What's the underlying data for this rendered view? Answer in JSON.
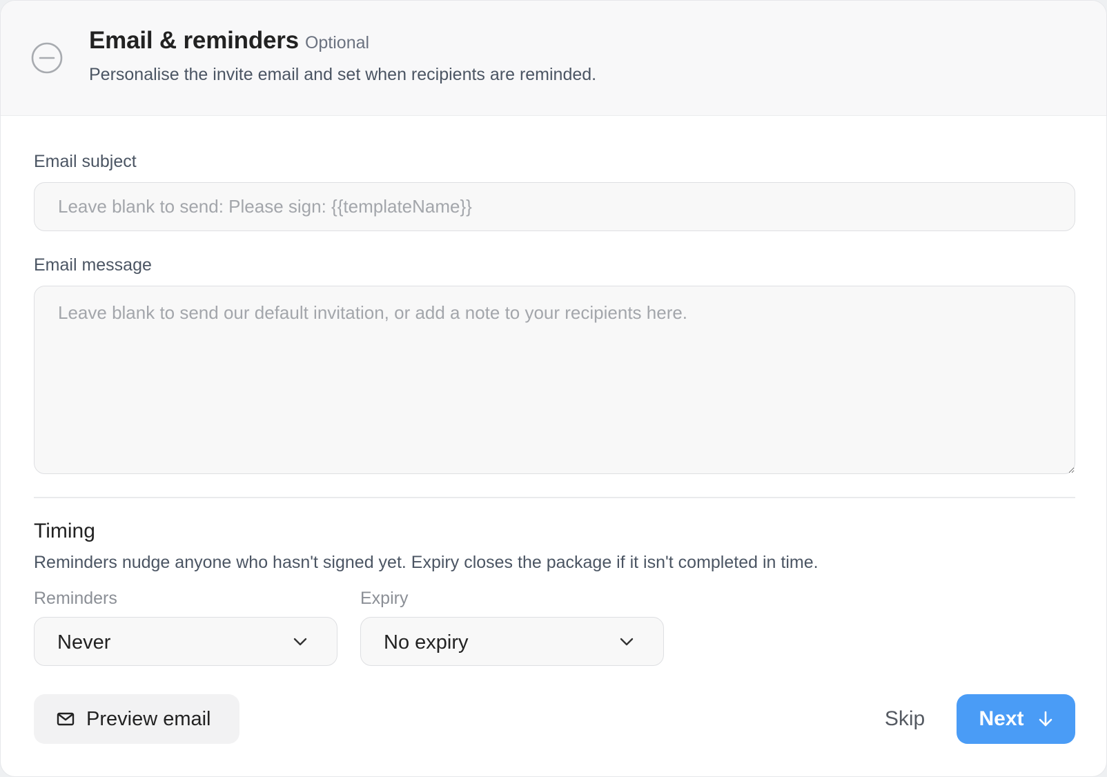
{
  "header": {
    "title": "Email & reminders",
    "optional_badge": "Optional",
    "subtitle": "Personalise the invite email and set when recipients are reminded.",
    "step_icon": "minus-circle-icon"
  },
  "email_subject": {
    "label": "Email subject",
    "value": "",
    "placeholder": "Leave blank to send: Please sign: {{templateName}}"
  },
  "email_message": {
    "label": "Email message",
    "value": "",
    "placeholder": "Leave blank to send our default invitation, or add a note to your recipients here."
  },
  "timing": {
    "title": "Timing",
    "description": "Reminders nudge anyone who hasn't signed yet. Expiry closes the package if it isn't completed in time.",
    "reminders": {
      "label": "Reminders",
      "selected": "Never"
    },
    "expiry": {
      "label": "Expiry",
      "selected": "No expiry"
    }
  },
  "footer": {
    "preview_label": "Preview email",
    "preview_icon": "mail-icon",
    "skip_label": "Skip",
    "next_label": "Next",
    "next_icon": "arrow-down-icon"
  },
  "colors": {
    "primary": "#4a9cf6",
    "header_bg": "#f8f8f9",
    "field_bg": "#f8f8f8"
  }
}
